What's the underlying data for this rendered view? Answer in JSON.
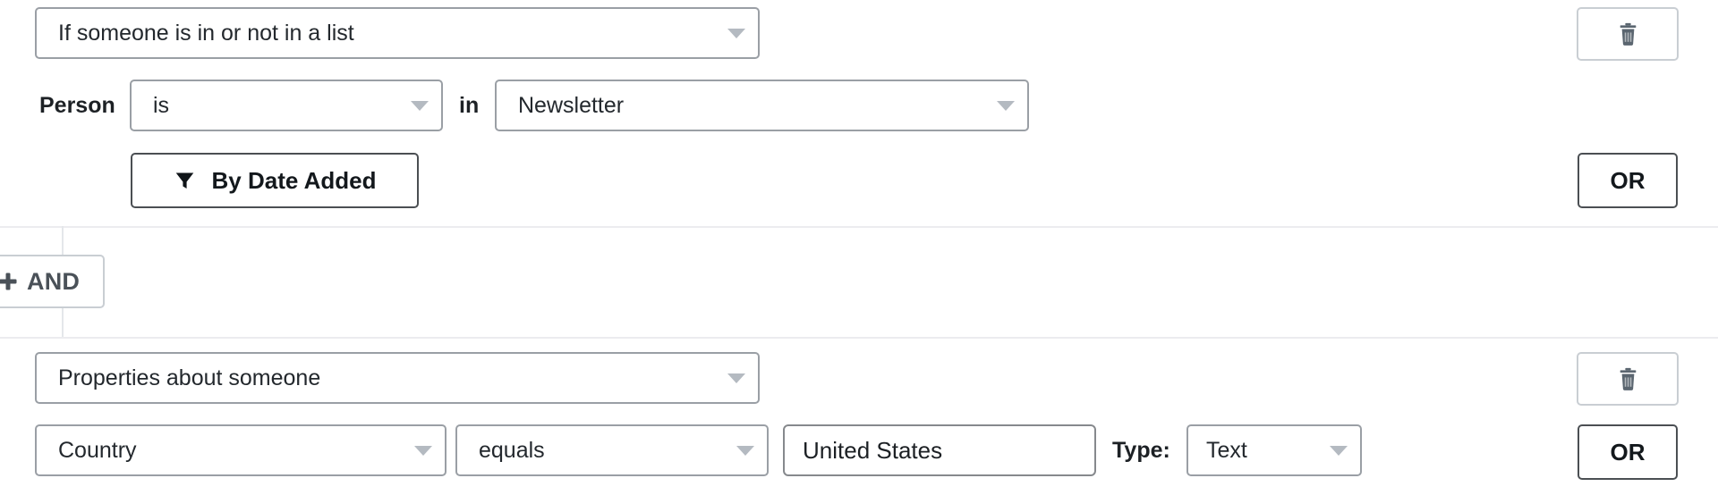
{
  "groups": [
    {
      "id": "list-membership-group",
      "type_select": {
        "name": "condition-type-select",
        "value": "If someone is in or not in a list",
        "icon": "chevron-down-icon"
      },
      "row": {
        "prefix_label": "Person",
        "operator_select": {
          "name": "list-operator-select",
          "value": "is"
        },
        "join_label": "in",
        "list_select": {
          "name": "list-name-select",
          "value": "Newsletter"
        }
      },
      "date_filter_button": {
        "name": "by-date-added-button",
        "label": "By Date Added",
        "icon": "filter-icon"
      },
      "delete_button": {
        "name": "delete-condition-button",
        "icon": "trash-icon"
      },
      "or_button": {
        "name": "add-or-condition-button",
        "label": "OR"
      }
    },
    {
      "id": "person-properties-group",
      "type_select": {
        "name": "condition-type-select",
        "value": "Properties about someone",
        "icon": "chevron-down-icon"
      },
      "row": {
        "property_select": {
          "name": "property-name-select",
          "value": "Country"
        },
        "comparator_select": {
          "name": "property-comparator-select",
          "value": "equals"
        },
        "value_input": {
          "name": "property-value-input",
          "value": "United States",
          "placeholder": ""
        },
        "type_label": "Type:",
        "type_select": {
          "name": "property-type-select",
          "value": "Text"
        }
      },
      "delete_button": {
        "name": "delete-condition-button",
        "icon": "trash-icon"
      },
      "or_button": {
        "name": "add-or-condition-button",
        "label": "OR"
      }
    }
  ],
  "and_button": {
    "name": "add-and-group-button",
    "label": "AND",
    "icon": "plus-icon"
  },
  "colors": {
    "select_border": "#9a9fa5",
    "input_border": "#86898d",
    "strong_border": "#4b4f53",
    "light_border": "#c9ced3",
    "divider": "#ececef",
    "connector": "#e4e7ea",
    "caret": "#b4bac1",
    "trash_icon": "#5b6670",
    "text": "#23282d"
  }
}
